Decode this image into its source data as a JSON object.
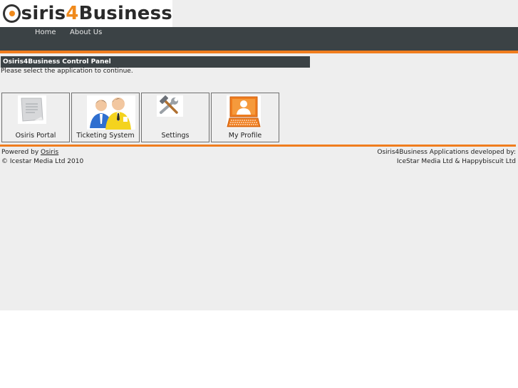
{
  "logo": {
    "part1": "siris",
    "part2": "4",
    "part3": "Business"
  },
  "nav": {
    "items": [
      {
        "label": "Home"
      },
      {
        "label": "About Us"
      }
    ]
  },
  "panel": {
    "title": "Osiris4Business Control Panel",
    "instruction": "Please select the application to continue."
  },
  "apps": [
    {
      "label": "Osiris Portal",
      "icon": "document-icon"
    },
    {
      "label": "Ticketing System",
      "icon": "users-icon"
    },
    {
      "label": "Settings",
      "icon": "tools-icon"
    },
    {
      "label": "My Profile",
      "icon": "profile-keyboard-icon"
    }
  ],
  "footer": {
    "powered_prefix": "Powered by ",
    "powered_link": "Osiris",
    "copyright": "© Icestar Media Ltd 2010",
    "dev_line1": "Osiris4Business Applications developed by:",
    "dev_line2": "IceStar Media Ltd & Happybiscuit Ltd"
  },
  "colors": {
    "accent": "#f07d1e",
    "nav_bg": "#3b4245",
    "page_bg": "#eeeeee"
  }
}
